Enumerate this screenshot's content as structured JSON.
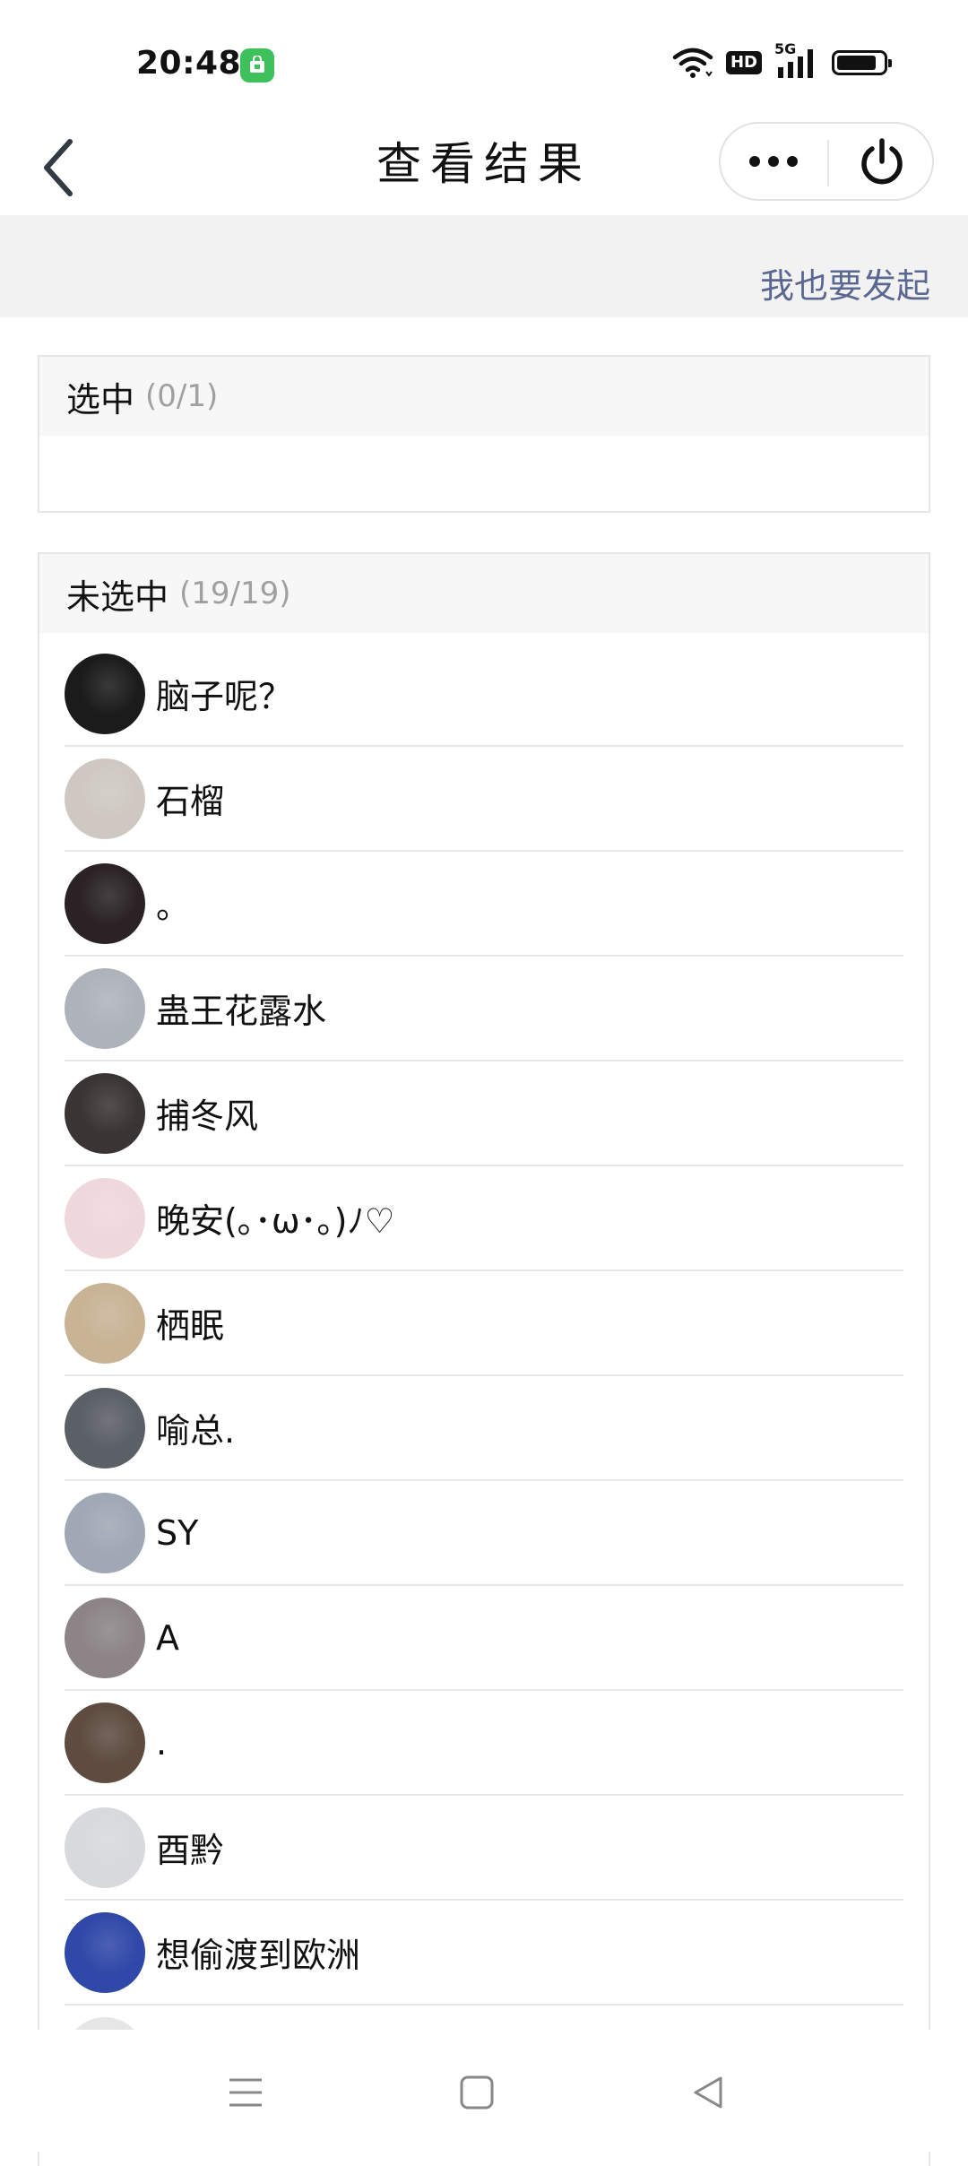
{
  "status_bar": {
    "time": "20:48",
    "hd_label": "HD",
    "network_label": "5G",
    "battery_level": 0.85
  },
  "nav": {
    "title": "查看结果"
  },
  "actions": {
    "start_label": "我也要发起"
  },
  "selected": {
    "title": "选中",
    "count": "(0/1)"
  },
  "unselected": {
    "title": "未选中",
    "count": "(19/19)",
    "members": [
      {
        "name": "脑子呢？",
        "avatar_color": "#1b1b1b"
      },
      {
        "name": "石榴",
        "avatar_color": "#cfc8c2"
      },
      {
        "name": "。",
        "avatar_color": "#2a2224"
      },
      {
        "name": "蛊王花露水",
        "avatar_color": "#aeb3bb"
      },
      {
        "name": "捕冬风",
        "avatar_color": "#3a3434"
      },
      {
        "name": "晚安(｡･ω･｡)ﾉ♡",
        "avatar_color": "#efd8dc"
      },
      {
        "name": "栖眠",
        "avatar_color": "#c8b395"
      },
      {
        "name": "喻总.",
        "avatar_color": "#5b5f66"
      },
      {
        "name": "SY",
        "avatar_color": "#9fa8b4"
      },
      {
        "name": "A",
        "avatar_color": "#8c8486"
      },
      {
        "name": ".",
        "avatar_color": "#5e4c40"
      },
      {
        "name": "酉黔",
        "avatar_color": "#d7d9dc"
      },
      {
        "name": "想偷渡到欧洲",
        "avatar_color": "#3048a8"
      },
      {
        "name": "",
        "avatar_color": "#e6e6e6"
      }
    ]
  }
}
